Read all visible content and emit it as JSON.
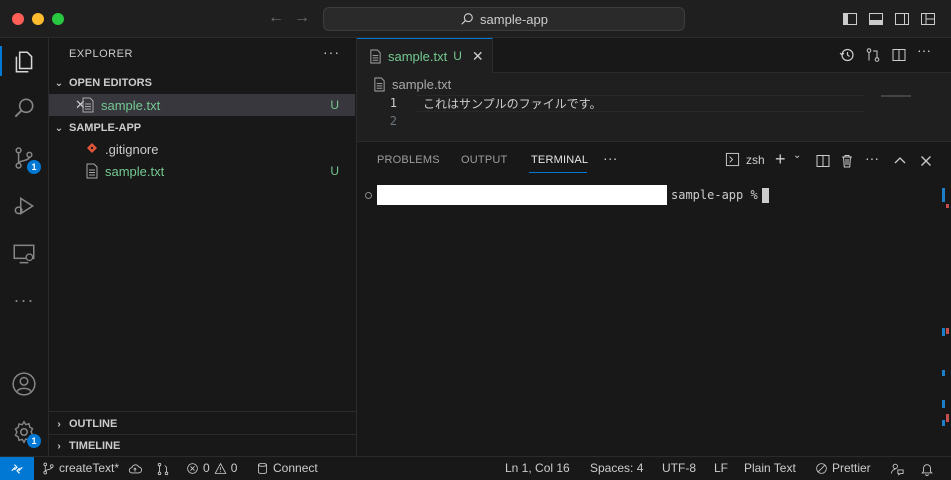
{
  "window": {
    "search_text": "sample-app"
  },
  "activity_bar": {
    "scm_badge": "1",
    "settings_badge": "1"
  },
  "sidebar": {
    "title": "EXPLORER",
    "more": "···",
    "open_editors": {
      "header": "OPEN EDITORS",
      "items": [
        {
          "label": "sample.txt",
          "status": "U"
        }
      ]
    },
    "project": {
      "header": "SAMPLE-APP",
      "items": [
        {
          "label": ".gitignore",
          "status": ""
        },
        {
          "label": "sample.txt",
          "status": "U"
        }
      ]
    },
    "outline_header": "OUTLINE",
    "timeline_header": "TIMELINE"
  },
  "editor": {
    "tab": {
      "label": "sample.txt",
      "status": "U",
      "close": "✕"
    },
    "breadcrumb": "sample.txt",
    "lines": [
      {
        "number": "1",
        "text": "これはサンプルのファイルです。"
      },
      {
        "number": "2",
        "text": ""
      }
    ]
  },
  "panel": {
    "tabs": [
      "PROBLEMS",
      "OUTPUT",
      "TERMINAL"
    ],
    "active_tab": "TERMINAL",
    "more": "···",
    "shell": "zsh",
    "terminal_prompt": "sample-app %"
  },
  "statusbar": {
    "branch": "createText*",
    "errors": "0",
    "warnings": "0",
    "connect": "Connect",
    "position": "Ln 1, Col 16",
    "spaces": "Spaces: 4",
    "encoding": "UTF-8",
    "eol": "LF",
    "language": "Plain Text",
    "formatter": "Prettier"
  },
  "colors": {
    "accent": "#0078d4",
    "untracked": "#73c991",
    "background": "#1f1f1f",
    "sidebar_bg": "#181818"
  }
}
